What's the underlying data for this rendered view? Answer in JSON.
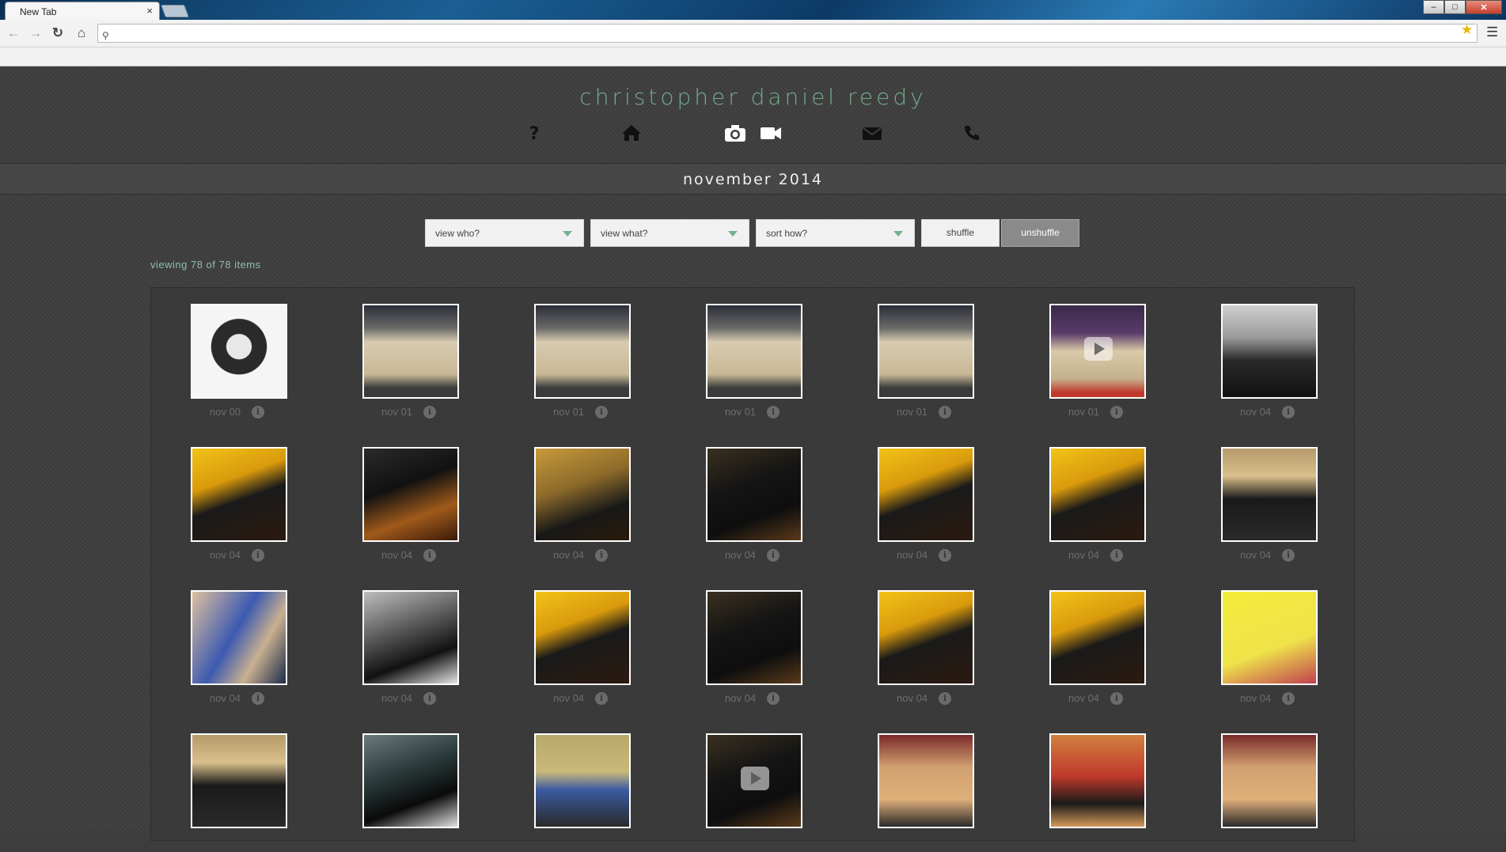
{
  "browser": {
    "tab_title": "New Tab",
    "tab_close": "×",
    "address": "",
    "window_controls": {
      "minimize": "–",
      "maximize": "□",
      "close": "✕"
    }
  },
  "site": {
    "title": "christopher daniel reedy",
    "nav_icons": [
      "question-icon",
      "home-icon",
      "camera-icon",
      "video-icon",
      "envelope-icon",
      "phone-icon"
    ]
  },
  "section": {
    "title": "november 2014"
  },
  "filters": {
    "who": "view who?",
    "what": "view what?",
    "sort": "sort how?",
    "shuffle": "shuffle",
    "unshuffle": "unshuffle"
  },
  "status": {
    "viewing": "viewing 78 of 78 items"
  },
  "accent_color": "#73ac8c",
  "info_glyph": "i",
  "gallery": {
    "items": [
      {
        "date": "nov 00",
        "tone": "bw-portrait",
        "video": false
      },
      {
        "date": "nov 01",
        "tone": "gym",
        "video": false
      },
      {
        "date": "nov 01",
        "tone": "gym",
        "video": false
      },
      {
        "date": "nov 01",
        "tone": "gym",
        "video": false
      },
      {
        "date": "nov 01",
        "tone": "gym",
        "video": false
      },
      {
        "date": "nov 01",
        "tone": "gym-purple",
        "video": true
      },
      {
        "date": "nov 04",
        "tone": "bw-crowd",
        "video": false
      },
      {
        "date": "nov 04",
        "tone": "orchestra-yellow",
        "video": false
      },
      {
        "date": "nov 04",
        "tone": "violin",
        "video": false
      },
      {
        "date": "nov 04",
        "tone": "orchestra-gold",
        "video": false
      },
      {
        "date": "nov 04",
        "tone": "orchestra-dark",
        "video": false
      },
      {
        "date": "nov 04",
        "tone": "orchestra-yellow",
        "video": false
      },
      {
        "date": "nov 04",
        "tone": "orchestra-yellow",
        "video": false
      },
      {
        "date": "nov 04",
        "tone": "crowd-gym",
        "video": false
      },
      {
        "date": "nov 04",
        "tone": "people-blue",
        "video": false
      },
      {
        "date": "nov 04",
        "tone": "bw-orchestra",
        "video": false
      },
      {
        "date": "nov 04",
        "tone": "orchestra-yellow",
        "video": false
      },
      {
        "date": "nov 04",
        "tone": "orchestra-dark",
        "video": false
      },
      {
        "date": "nov 04",
        "tone": "orchestra-yellow",
        "video": false
      },
      {
        "date": "nov 04",
        "tone": "orchestra-yellow",
        "video": false
      },
      {
        "date": "nov 04",
        "tone": "program",
        "video": false
      },
      {
        "date": "",
        "tone": "crowd-gym",
        "video": false
      },
      {
        "date": "",
        "tone": "boy-locker",
        "video": false
      },
      {
        "date": "",
        "tone": "family",
        "video": false
      },
      {
        "date": "",
        "tone": "orchestra-dark",
        "video": true
      },
      {
        "date": "",
        "tone": "gym-wood",
        "video": false
      },
      {
        "date": "",
        "tone": "red-team",
        "video": false
      },
      {
        "date": "",
        "tone": "gym-wood",
        "video": false
      }
    ]
  }
}
